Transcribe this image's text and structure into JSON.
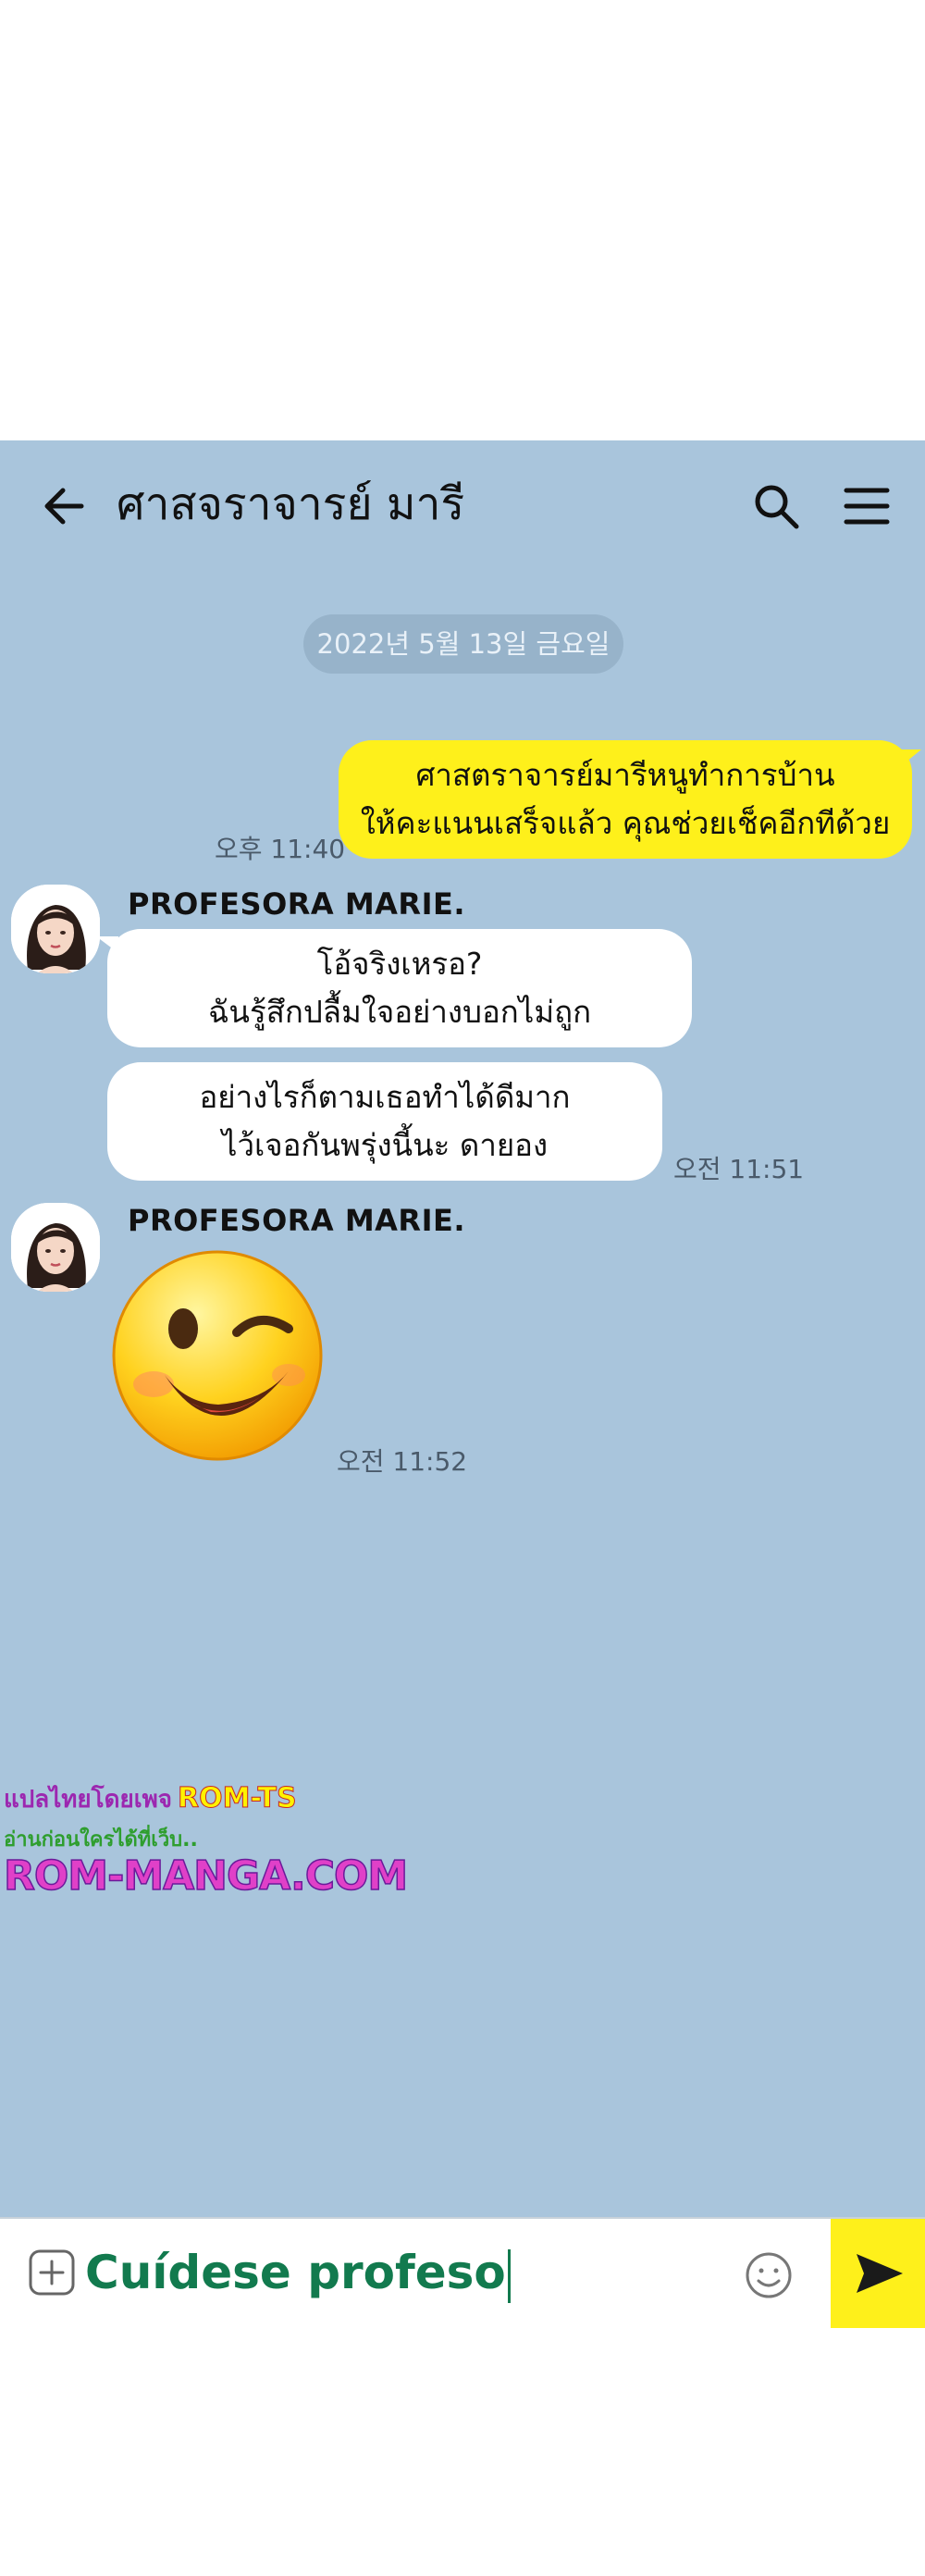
{
  "header": {
    "title": "ศาสจราจารย์ มารี",
    "back_icon": "arrow-left-icon",
    "search_icon": "search-icon",
    "menu_icon": "hamburger-menu-icon"
  },
  "date_divider": "2022년 5월 13일 금요일",
  "messages": {
    "outgoing": {
      "lines": [
        "ศาสตราจารย์มารีหนูทำการบ้าน",
        "ให้คะแนนเสร็จแล้ว คุณช่วยเช็คอีกทีด้วย"
      ],
      "time": "오후 11:40"
    },
    "incoming_group_1": {
      "sender": "PROFESORA MARIE.",
      "bubble_1": [
        "โอ้จริงเหรอ?",
        "ฉันรู้สึกปลื้มใจอย่างบอกไม่ถูก"
      ],
      "bubble_2": [
        "อย่างไรก็ตามเธอทำได้ดีมาก",
        "ไว้เจอกันพรุ่งนี้นะ ดายอง"
      ],
      "time": "오전 11:51"
    },
    "incoming_group_2": {
      "sender": "PROFESORA MARIE.",
      "sticker": "winking-face-emoji",
      "time": "오전 11:52"
    }
  },
  "watermark": {
    "line1_prefix": "แปลไทยโดยเพจ",
    "line1_brand": "ROM-TS",
    "line2": "อ่านก่อนใครได้ที่เว็บ..",
    "line3": "ROM-MANGA.COM"
  },
  "input_bar": {
    "value": "Cuídese profeso",
    "plus_icon": "plus-square-icon",
    "emoji_icon": "smiley-icon",
    "send_icon": "send-arrow-icon"
  },
  "colors": {
    "chat_background": "#a9c5dc",
    "outgoing_bubble": "#fef01b",
    "incoming_bubble": "#ffffff",
    "send_button": "#fef01b",
    "typed_text": "#127a4e"
  }
}
